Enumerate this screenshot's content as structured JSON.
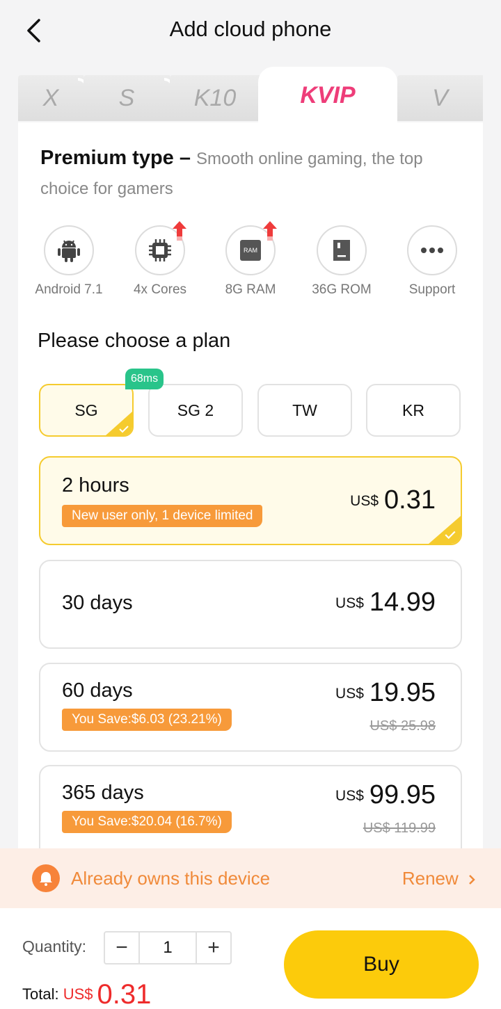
{
  "header": {
    "title": "Add cloud phone",
    "back_icon": "chevron-left-icon"
  },
  "tabs": [
    {
      "label": "X",
      "active": false
    },
    {
      "label": "S",
      "active": false
    },
    {
      "label": "K10",
      "active": false
    },
    {
      "label": "KVIP",
      "active": true
    },
    {
      "label": "V",
      "active": false
    }
  ],
  "premium": {
    "type": "Premium type",
    "dash": " – ",
    "description": "Smooth online gaming, the top choice for gamers"
  },
  "specs": [
    {
      "icon": "android-icon",
      "label": "Android 7.1"
    },
    {
      "icon": "cpu-icon",
      "label": "4x Cores",
      "upgraded": true
    },
    {
      "icon": "ram-icon",
      "icon_text": "RAM",
      "label": "8G RAM",
      "upgraded": true
    },
    {
      "icon": "sd-card-icon",
      "label": "36G ROM"
    },
    {
      "icon": "more-icon",
      "label": "Support"
    }
  ],
  "plan_heading": "Please choose a plan",
  "regions": [
    {
      "label": "SG",
      "selected": true,
      "latency": "68ms"
    },
    {
      "label": "SG 2",
      "selected": false
    },
    {
      "label": "TW",
      "selected": false
    },
    {
      "label": "KR",
      "selected": false
    }
  ],
  "plans": [
    {
      "duration": "2 hours",
      "tag": "New user only, 1 device limited",
      "currency": "US$",
      "price": "0.31",
      "selected": true
    },
    {
      "duration": "30 days",
      "currency": "US$",
      "price": "14.99",
      "selected": false
    },
    {
      "duration": "60 days",
      "tag": "You Save:$6.03 (23.21%)",
      "currency": "US$",
      "price": "19.95",
      "original": "US$ 25.98",
      "selected": false
    },
    {
      "duration": "365 days",
      "tag": "You Save:$20.04 (16.7%)",
      "currency": "US$",
      "price": "99.95",
      "original": "US$ 119.99",
      "selected": false
    }
  ],
  "owns_bar": {
    "text": "Already owns this device",
    "action": "Renew",
    "icon": "bell-icon"
  },
  "purchase": {
    "quantity_label": "Quantity:",
    "quantity": "1",
    "minus": "−",
    "plus": "+",
    "total_label": "Total:",
    "total_currency": "US$",
    "total_amount": "0.31",
    "buy_label": "Buy"
  },
  "colors": {
    "accent_pink": "#ee3d79",
    "accent_yellow": "#fccb0b",
    "selected_border": "#f5cb2e",
    "tag_orange": "#f79a3a",
    "latency_green": "#29c48a",
    "price_red": "#ee2b2b"
  }
}
